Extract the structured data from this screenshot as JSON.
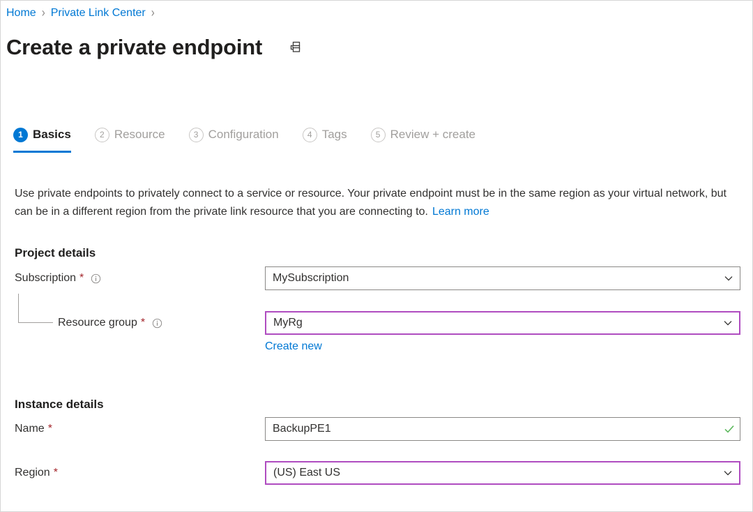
{
  "breadcrumb": {
    "items": [
      {
        "label": "Home"
      },
      {
        "label": "Private Link Center"
      }
    ],
    "separator": "›"
  },
  "header": {
    "title": "Create a private endpoint",
    "print_icon": "printer-icon"
  },
  "tabs": [
    {
      "num": "1",
      "label": "Basics",
      "active": true
    },
    {
      "num": "2",
      "label": "Resource",
      "active": false
    },
    {
      "num": "3",
      "label": "Configuration",
      "active": false
    },
    {
      "num": "4",
      "label": "Tags",
      "active": false
    },
    {
      "num": "5",
      "label": "Review + create",
      "active": false
    }
  ],
  "description": {
    "text": "Use private endpoints to privately connect to a service or resource. Your private endpoint must be in the same region as your virtual network, but can be in a different region from the private link resource that you are connecting to.",
    "learn_more": "Learn more"
  },
  "project_details": {
    "heading": "Project details",
    "subscription": {
      "label": "Subscription",
      "required_marker": "*",
      "info_icon": "info-icon",
      "value": "MySubscription",
      "chevron_icon": "chevron-down-icon"
    },
    "resource_group": {
      "label": "Resource group",
      "required_marker": "*",
      "info_icon": "info-icon",
      "value": "MyRg",
      "chevron_icon": "chevron-down-icon",
      "create_new": "Create new"
    }
  },
  "instance_details": {
    "heading": "Instance details",
    "name": {
      "label": "Name",
      "required_marker": "*",
      "value": "BackupPE1",
      "placeholder": "",
      "valid_icon": "checkmark-icon"
    },
    "region": {
      "label": "Region",
      "required_marker": "*",
      "value": "(US) East US",
      "chevron_icon": "chevron-down-icon"
    }
  },
  "colors": {
    "accent_blue": "#0078d4",
    "link_blue": "#0078d4",
    "required_red": "#a4262c",
    "focus_purple": "#af4cc0",
    "valid_green": "#5cb85c",
    "border_gray": "#8a8886",
    "disabled_gray": "#a19f9d"
  }
}
